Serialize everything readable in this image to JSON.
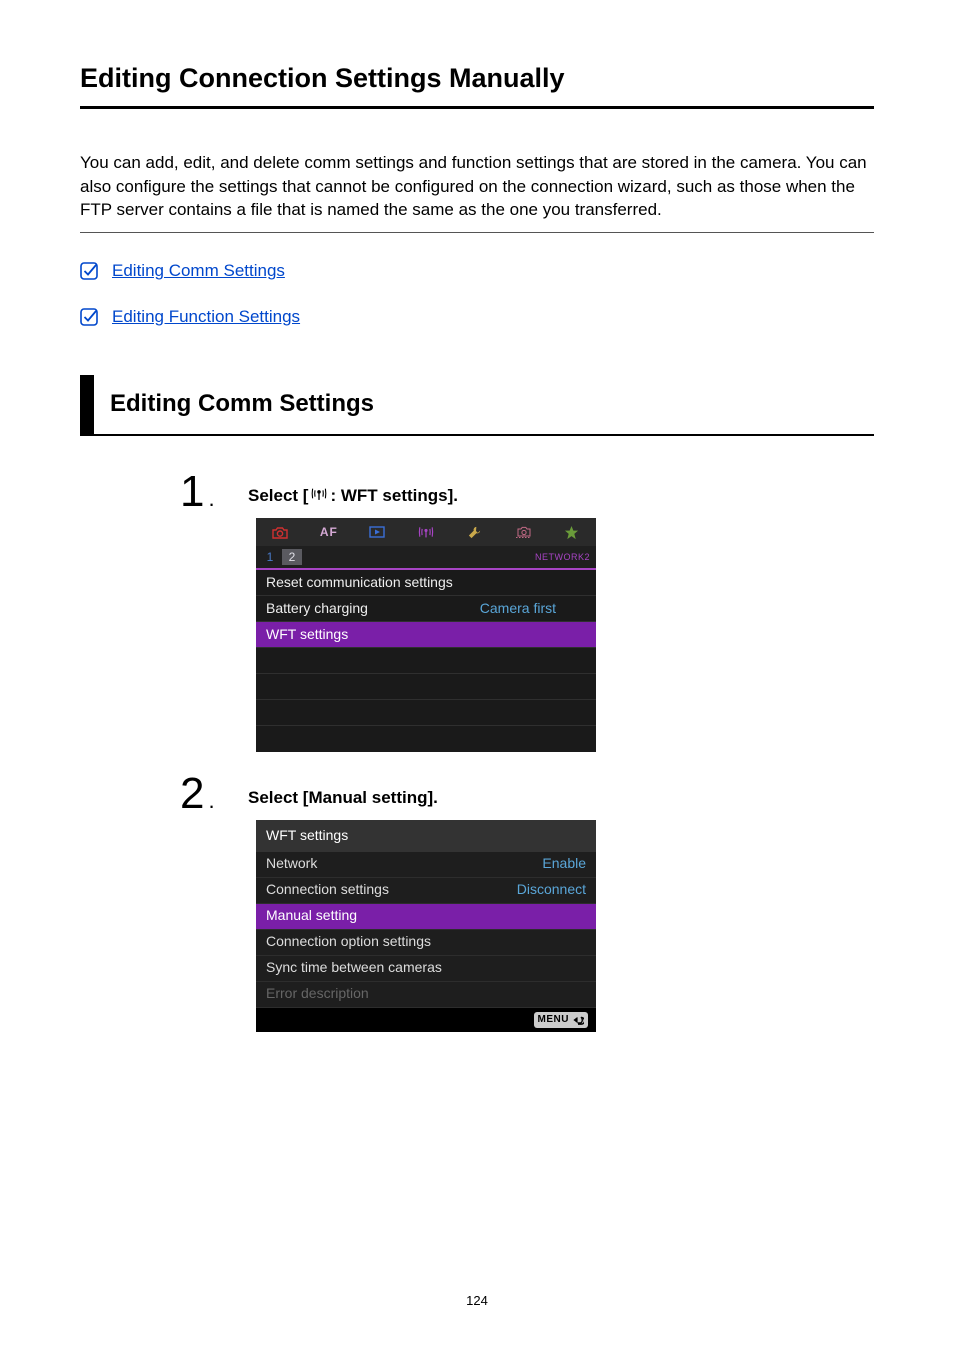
{
  "page": {
    "title": "Editing Connection Settings Manually",
    "intro": "You can add, edit, and delete comm settings and function settings that are stored in the camera. You can also configure the settings that cannot be configured on the connection wizard, such as those when the FTP server contains a file that is named the same as the one you transferred.",
    "page_number": "124"
  },
  "links": {
    "comm": "Editing Comm Settings",
    "func": "Editing Function Settings"
  },
  "section": {
    "heading": "Editing Comm Settings"
  },
  "step1": {
    "num": "1",
    "prefix": "Select [",
    "suffix": ": WFT settings]."
  },
  "step2": {
    "num": "2",
    "title": "Select [Manual setting]."
  },
  "menu1": {
    "tabs": {
      "af": "AF"
    },
    "subtabs": {
      "t1": "1",
      "t2": "2",
      "label": "NETWORK2"
    },
    "row1": "Reset communication settings",
    "row2_label": "Battery charging",
    "row2_value": "Camera first",
    "row3": "WFT settings"
  },
  "menu2": {
    "header": "WFT settings",
    "r1_label": "Network",
    "r1_value": "Enable",
    "r2_label": "Connection settings",
    "r2_value": "Disconnect",
    "r3": "Manual setting",
    "r4": "Connection option settings",
    "r5": "Sync time between cameras",
    "r6": "Error description",
    "menu_btn": "MENU"
  }
}
